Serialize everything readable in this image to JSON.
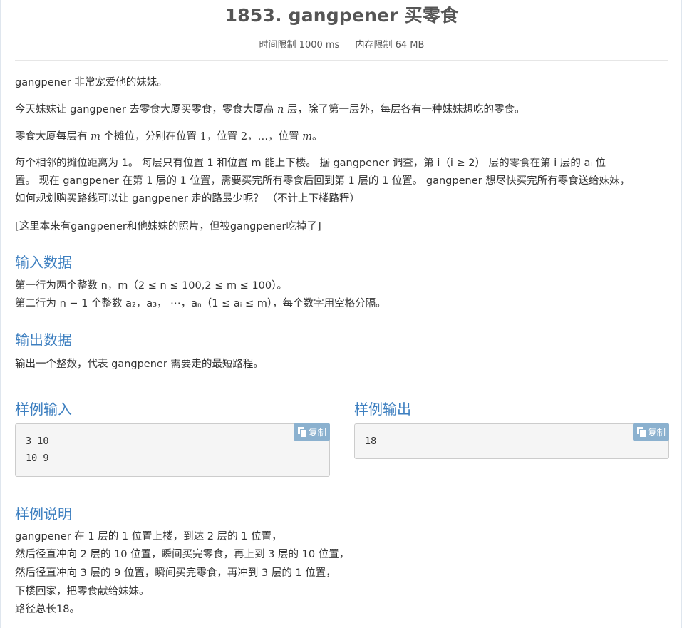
{
  "problem": {
    "title": "1853. gangpener 买零食",
    "time_limit": "时间限制 1000 ms",
    "memory_limit": "内存限制 64 MB"
  },
  "description": {
    "p1": "gangpener 非常宠爱他的妹妹。",
    "p2_a": "今天妹妹让 gangpener 去零食大厦买零食，零食大厦高 ",
    "p2_n": "n",
    "p2_b": " 层，除了第一层外，每层各有一种妹妹想吃的零食。",
    "p3_a": "零食大厦每层有 ",
    "p3_m": "m",
    "p3_b": " 个摊位，分别在位置 ",
    "p3_1": "1",
    "p3_c": "，位置 ",
    "p3_2": "2",
    "p3_d": "，…，位置 ",
    "p3_m2": "m",
    "p3_e": "。",
    "p4_l1": "每个相邻的摊位距离为 1。 每层只有位置 1 和位置 m 能上下楼。 据 gangpener 调查，第 i（i ≥ 2） 层的零食在第 i 层的 aᵢ 位",
    "p4_l2": "置。 现在 gangpener 在第 1 层的 1 位置，需要买完所有零食后回到第 1 层的 1 位置。 gangpener 想尽快买完所有零食送给妹妹，",
    "p4_l3": "如何规划购买路线可以让 gangpener 走的路最少呢？ （不计上下楼路程）",
    "p5": "[这里本来有gangpener和他妹妹的照片，但被gangpener吃掉了]"
  },
  "input_section": {
    "heading": "输入数据",
    "line1": "第一行为两个整数 n，m（2 ≤ n ≤ 100,2 ≤ m ≤ 100）。",
    "line2": "第二行为 n − 1 个整数 a₂，a₃， ⋯，aₙ（1 ≤ aᵢ ≤ m），每个数字用空格分隔。"
  },
  "output_section": {
    "heading": "输出数据",
    "line1": "输出一个整数，代表 gangpener 需要走的最短路程。"
  },
  "sample_input": {
    "heading": "样例输入",
    "copy_label": "复制",
    "lines": [
      "3 10",
      "10 9"
    ]
  },
  "sample_output": {
    "heading": "样例输出",
    "copy_label": "复制",
    "lines": [
      "18"
    ]
  },
  "explanation": {
    "heading": "样例说明",
    "lines": [
      "gangpener 在 1 层的 1 位置上楼，到达 2 层的 1 位置，",
      "然后径直冲向 2 层的 10 位置，瞬间买完零食，再上到 3 层的 10 位置，",
      "然后径直冲向 3 层的 9 位置，瞬间买完零食，再冲到 3 层的 1 位置，",
      "下楼回家，把零食献给妹妹。",
      "路径总长18。"
    ]
  }
}
